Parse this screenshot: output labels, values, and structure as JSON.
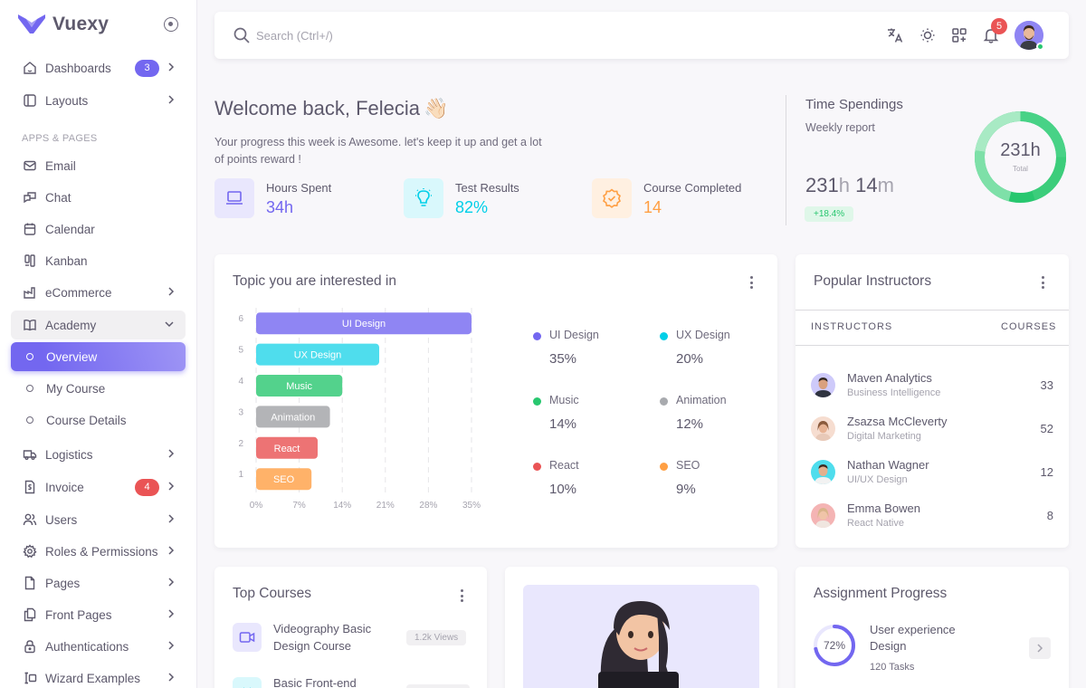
{
  "brand": {
    "name": "Vuexy"
  },
  "colors": {
    "primary": "#7367f0",
    "success": "#28c76f",
    "info": "#00cfe8",
    "warning": "#ff9f43",
    "danger": "#ea5455",
    "secondary": "#a8aaae"
  },
  "sidebar": {
    "section_header": "APPS & PAGES",
    "items": [
      {
        "label": "Dashboards",
        "icon": "home-icon",
        "badge": "3"
      },
      {
        "label": "Layouts",
        "icon": "layout-icon"
      },
      {
        "label": "Email",
        "icon": "mail-icon"
      },
      {
        "label": "Chat",
        "icon": "chat-icon"
      },
      {
        "label": "Calendar",
        "icon": "calendar-icon"
      },
      {
        "label": "Kanban",
        "icon": "kanban-icon"
      },
      {
        "label": "eCommerce",
        "icon": "shop-icon"
      },
      {
        "label": "Academy",
        "icon": "book-icon"
      },
      {
        "label": "Overview"
      },
      {
        "label": "My Course"
      },
      {
        "label": "Course Details"
      },
      {
        "label": "Logistics",
        "icon": "truck-icon"
      },
      {
        "label": "Invoice",
        "icon": "invoice-icon",
        "badge": "4"
      },
      {
        "label": "Users",
        "icon": "users-icon"
      },
      {
        "label": "Roles & Permissions",
        "icon": "settings-icon"
      },
      {
        "label": "Pages",
        "icon": "file-icon"
      },
      {
        "label": "Front Pages",
        "icon": "files-icon"
      },
      {
        "label": "Authentications",
        "icon": "lock-icon"
      },
      {
        "label": "Wizard Examples",
        "icon": "forms-icon"
      }
    ]
  },
  "navbar": {
    "search_placeholder": "Search (Ctrl+/)",
    "notifications": "5"
  },
  "welcome": {
    "title": "Welcome back, Felecia",
    "emoji": "👋🏻",
    "text": "Your progress this week is Awesome. let's keep it up and get a lot of points reward !",
    "stats": [
      {
        "label": "Hours Spent",
        "value": "34h",
        "color": "#7367f0",
        "icon": "laptop-icon"
      },
      {
        "label": "Test Results",
        "value": "82%",
        "color": "#00cfe8",
        "icon": "bulb-icon"
      },
      {
        "label": "Course Completed",
        "value": "14",
        "color": "#ff9f43",
        "icon": "discount-check-icon"
      }
    ]
  },
  "time_spendings": {
    "title": "Time Spendings",
    "subtitle": "Weekly report",
    "value_h": "231",
    "unit_h": "h",
    "value_m": "14",
    "unit_m": "m",
    "badge": "+18.4%",
    "ring_value": "231h",
    "ring_label": "Total"
  },
  "topics": {
    "title": "Topic you are interested in",
    "legend": [
      {
        "name": "UI Design",
        "value": "35%",
        "color": "#7367f0"
      },
      {
        "name": "UX Design",
        "value": "20%",
        "color": "#00cfe8"
      },
      {
        "name": "Music",
        "value": "14%",
        "color": "#28c76f"
      },
      {
        "name": "Animation",
        "value": "12%",
        "color": "#a8aaae"
      },
      {
        "name": "React",
        "value": "10%",
        "color": "#ea5455"
      },
      {
        "name": "SEO",
        "value": "9%",
        "color": "#ff9f43"
      }
    ]
  },
  "chart_data": {
    "type": "bar",
    "orientation": "horizontal",
    "categories": [
      "UI Design",
      "UX Design",
      "Music",
      "Animation",
      "React",
      "SEO"
    ],
    "y_tick_labels": [
      "6",
      "5",
      "4",
      "3",
      "2",
      "1"
    ],
    "values": [
      35,
      20,
      14,
      12,
      10,
      9
    ],
    "colors": [
      "#8f85f3",
      "#4fdded",
      "#53d28c",
      "#b3b4b7",
      "#ed7374",
      "#ffb269"
    ],
    "x_ticks": [
      "0%",
      "7%",
      "14%",
      "21%",
      "28%",
      "35%"
    ],
    "xlim": [
      0,
      35
    ],
    "grid": true
  },
  "instructors": {
    "title": "Popular Instructors",
    "col_instructors": "INSTRUCTORS",
    "col_courses": "COURSES",
    "rows": [
      {
        "name": "Maven Analytics",
        "role": "Business Intelligence",
        "courses": "33",
        "avatar_color": "#e1def5"
      },
      {
        "name": "Zsazsa McCleverty",
        "role": "Digital Marketing",
        "courses": "52",
        "avatar_color": "#f6ddd0"
      },
      {
        "name": "Nathan Wagner",
        "role": "UI/UX Design",
        "courses": "12",
        "avatar_color": "#cdeff3"
      },
      {
        "name": "Emma Bowen",
        "role": "React Native",
        "courses": "8",
        "avatar_color": "#f7d6d6"
      }
    ]
  },
  "top_courses": {
    "title": "Top Courses",
    "items": [
      {
        "title": "Videography Basic Design Course",
        "views": "1.2k Views",
        "icon": "video-icon",
        "color": "#7367f0"
      },
      {
        "title": "Basic Front-end",
        "views": "",
        "icon": "code-icon",
        "color": "#00cfe8"
      }
    ]
  },
  "assignment": {
    "title": "Assignment Progress",
    "items": [
      {
        "percent": "72%",
        "progress": 0.72,
        "title": "User experience Design",
        "tasks": "120 Tasks"
      }
    ]
  }
}
